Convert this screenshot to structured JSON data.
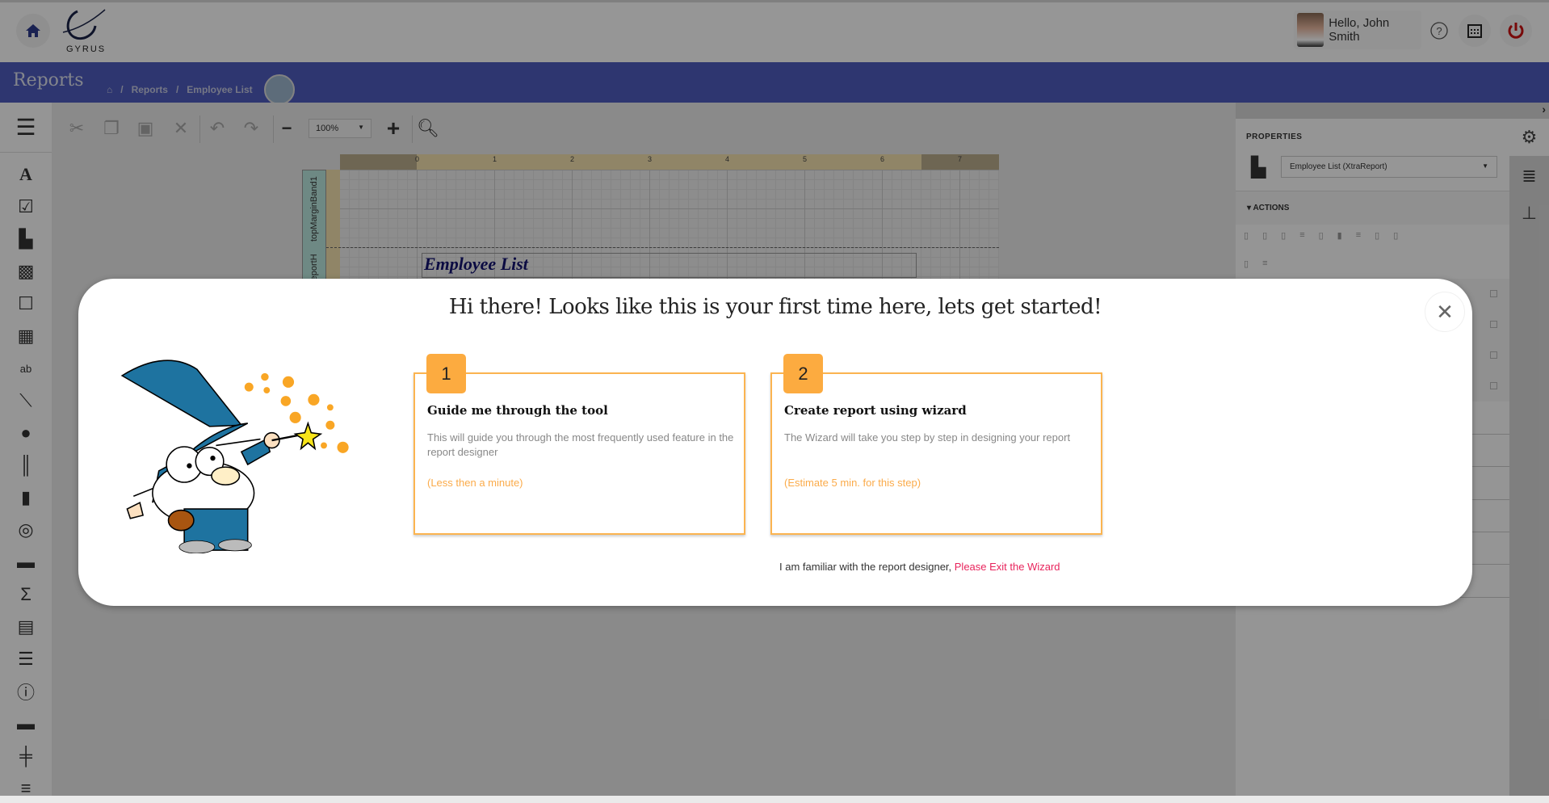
{
  "header": {
    "logo_text": "GYRUS",
    "greeting": "Hello, John Smith",
    "icons": [
      "home-icon",
      "help-icon",
      "calendar-icon",
      "power-icon"
    ],
    "power_color": "#cc1111"
  },
  "nav": {
    "section_title": "Reports",
    "breadcrumb": [
      "Reports",
      "Employee List"
    ],
    "bar_color": "#4e5dbf"
  },
  "toolbar": {
    "zoom_value": "100%",
    "icons": [
      "cut-icon",
      "copy-icon",
      "paste-icon",
      "delete-icon",
      "undo-icon",
      "redo-icon",
      "zoom-out-icon",
      "zoom-in-icon",
      "preview-icon"
    ]
  },
  "toolbox": {
    "items": [
      "text-label",
      "checkbox",
      "rich-text",
      "picture",
      "panel",
      "table",
      "character-comb",
      "line",
      "shape",
      "barcode",
      "chart",
      "gauge",
      "sparkline",
      "summary",
      "subreport",
      "table-of-contents",
      "page-info",
      "cross-band",
      "page-break",
      "separator"
    ]
  },
  "designer": {
    "ruler_labels": [
      "0",
      "1",
      "2",
      "3",
      "4",
      "5",
      "6",
      "7"
    ],
    "bands": [
      "topMarginBand1",
      "reportH"
    ],
    "report_title": "Employee List"
  },
  "properties": {
    "title": "PROPERTIES",
    "selected_component": "Employee List (XtraReport)",
    "actions_label": "ACTIONS"
  },
  "modal": {
    "title": "Hi there! Looks like this is your first time here, lets get started!",
    "cards": [
      {
        "number": "1",
        "heading": "Guide me through the tool",
        "description": "This will guide you through the most frequently used feature in the report designer",
        "estimate": "(Less then a minute)"
      },
      {
        "number": "2",
        "heading": "Create report using wizard",
        "description": "The Wizard will take you step by step in designing your report",
        "estimate": "(Estimate 5 min. for this step)"
      }
    ],
    "footer_text": "I am familiar with the report designer, ",
    "exit_link": "Please Exit the Wizard",
    "accent_color": "#fcab40",
    "link_color": "#e8245c"
  }
}
